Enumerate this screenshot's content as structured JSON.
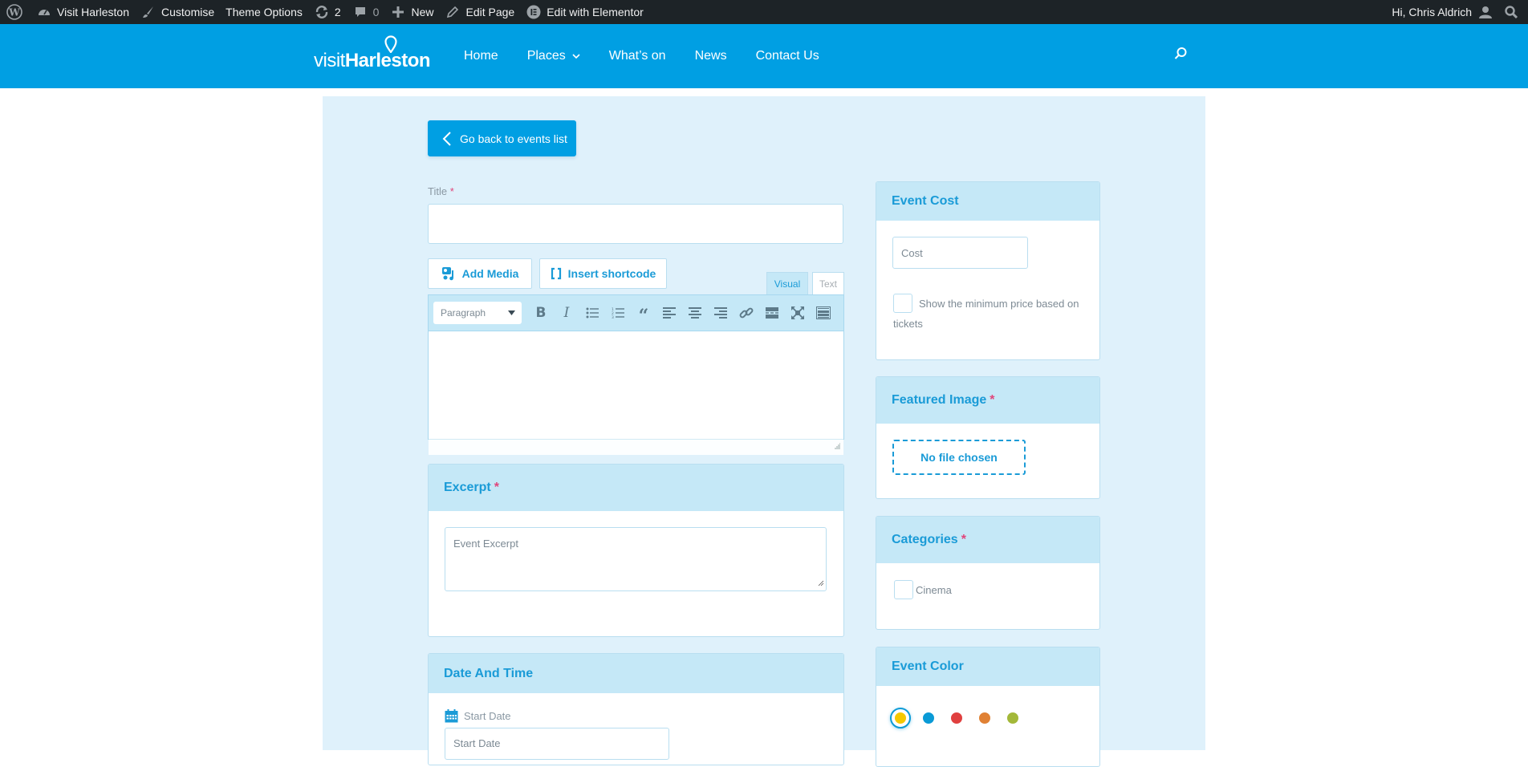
{
  "admin_bar": {
    "site_name": "Visit Harleston",
    "customise": "Customise",
    "theme_options": "Theme Options",
    "updates_count": "2",
    "comments_count": "0",
    "new": "New",
    "edit_page": "Edit Page",
    "edit_elementor": "Edit with Elementor",
    "greeting": "Hi, Chris Aldrich"
  },
  "header": {
    "logo_visit": "visit",
    "logo_harleston": "Harleston",
    "nav": [
      {
        "label": "Home"
      },
      {
        "label": "Places",
        "has_dropdown": true
      },
      {
        "label": "What’s on"
      },
      {
        "label": "News"
      },
      {
        "label": "Contact Us"
      }
    ],
    "brand_color": "#009fe3"
  },
  "form": {
    "back_button": "Go back to events list",
    "title_label": "Title",
    "required_mark": "*",
    "title_value": "",
    "add_media": "Add Media",
    "insert_shortcode": "Insert shortcode",
    "tab_visual": "Visual",
    "tab_text": "Text",
    "format_select": "Paragraph",
    "toolbar_buttons": [
      "bold",
      "italic",
      "bulleted-list",
      "numbered-list",
      "blockquote",
      "align-left",
      "align-center",
      "align-right",
      "link",
      "read-more",
      "fullscreen",
      "toolbar-toggle"
    ],
    "excerpt": {
      "heading": "Excerpt",
      "placeholder": "Event Excerpt"
    },
    "date_time": {
      "heading": "Date And Time",
      "start_label": "Start Date",
      "start_placeholder": "Start Date"
    }
  },
  "sidebar": {
    "event_cost": {
      "heading": "Event Cost",
      "placeholder": "Cost",
      "min_price_label": "Show the minimum price based on tickets",
      "min_price_checked": false
    },
    "featured_image": {
      "heading": "Featured Image",
      "file_status": "No file chosen"
    },
    "categories": {
      "heading": "Categories",
      "items": [
        {
          "label": "Cinema",
          "checked": false
        }
      ]
    },
    "event_color": {
      "heading": "Event Color",
      "colors": [
        "#f5c800",
        "#0a9ad6",
        "#e0403f",
        "#e08134",
        "#a3b839"
      ],
      "selected_index": 0
    }
  }
}
